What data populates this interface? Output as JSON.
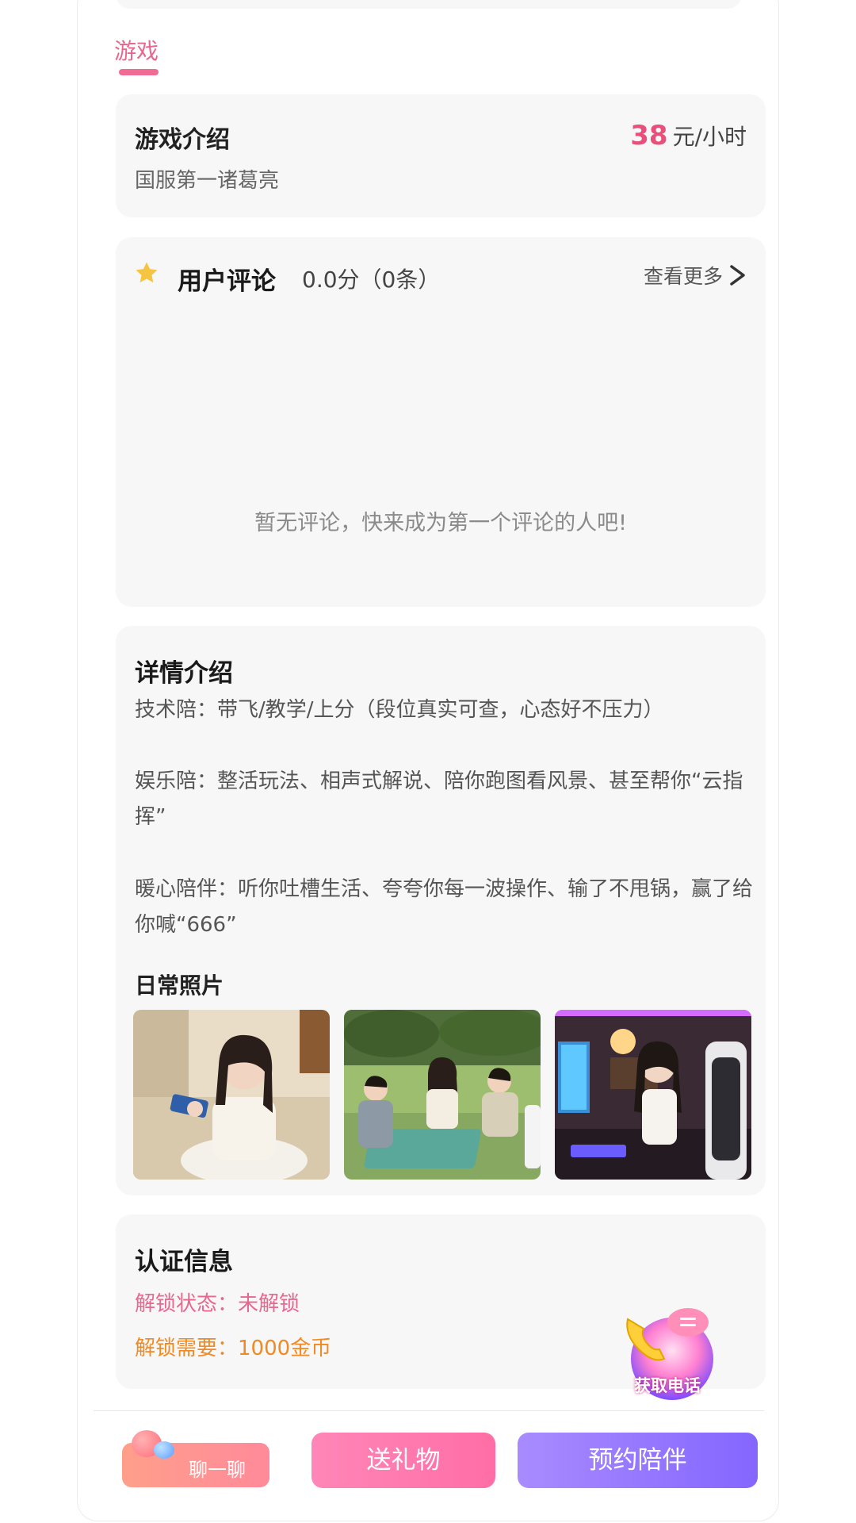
{
  "tab": {
    "label": "游戏"
  },
  "game_intro": {
    "title": "游戏介绍",
    "subtitle": "国服第一诸葛亮",
    "price_value": "38",
    "price_unit": "元/小时"
  },
  "reviews": {
    "title": "用户评论",
    "score": "0.0分（0条）",
    "more_label": "查看更多",
    "empty_text": "暂无评论，快来成为第一个评论的人吧!"
  },
  "details": {
    "title": "详情介绍",
    "paragraphs": [
      "技术陪：带飞/教学/上分（段位真实可查，心态好不压力）",
      "娱乐陪：整活玩法、相声式解说、陪你跑图看风景、甚至帮你“云指挥”",
      "暖心陪伴：听你吐槽生活、夸夸你每一波操作、输了不甩锅，赢了给你喊“666”"
    ],
    "photos_title": "日常照片"
  },
  "auth": {
    "title": "认证信息",
    "unlock_status": "解锁状态：未解锁",
    "unlock_require": "解锁需要：1000金币"
  },
  "call_button": {
    "label": "获取电话"
  },
  "bottom_bar": {
    "chat_label": "聊一聊",
    "gift_label": "送礼物",
    "book_label": "预约陪伴"
  }
}
